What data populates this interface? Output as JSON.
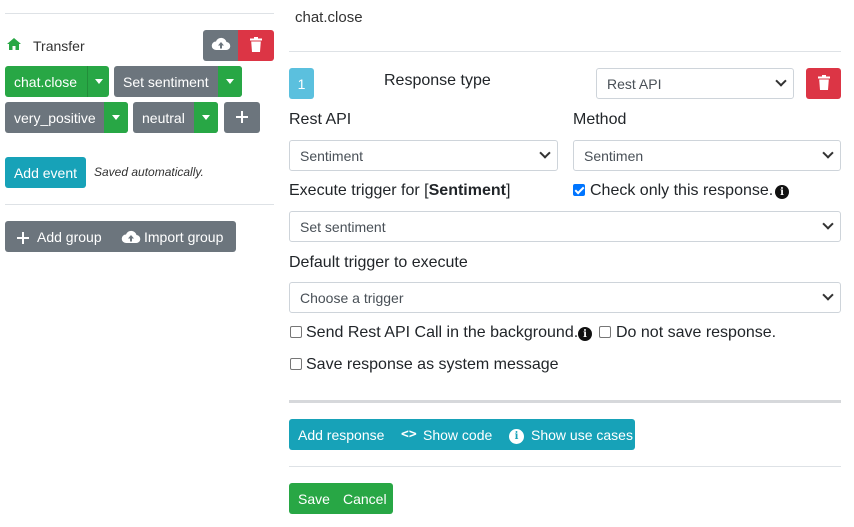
{
  "sidebar": {
    "home_label": "Transfer",
    "events": [
      {
        "label": "chat.close"
      },
      {
        "label": "Set sentiment"
      },
      {
        "label": "very_positive"
      },
      {
        "label": "neutral"
      }
    ],
    "add_event_label": "Add event",
    "saved_note": "Saved automatically.",
    "add_group_label": "Add group",
    "import_group_label": "Import group"
  },
  "main": {
    "title": "chat.close",
    "response_number": "1",
    "response_type_label": "Response type",
    "response_type_value": "Rest API",
    "rest_api_label": "Rest API",
    "rest_api_value": "Sentiment",
    "method_label": "Method",
    "method_value": "Sentimen",
    "execute_trigger_prefix": "Execute trigger for [",
    "execute_trigger_name": "Sentiment",
    "execute_trigger_suffix": "]",
    "check_only_label": "Check only this response.",
    "execute_trigger_value": "Set sentiment",
    "default_trigger_label": "Default trigger to execute",
    "default_trigger_placeholder": "Choose a trigger",
    "send_background_label": "Send Rest API Call in the background.",
    "do_not_save_label": "Do not save response.",
    "save_system_label": "Save response as system message",
    "add_response_label": "Add response",
    "show_code_label": "Show code",
    "show_use_cases_label": "Show use cases",
    "save_label": "Save",
    "cancel_label": "Cancel"
  },
  "colors": {
    "green": "#28a745",
    "gray": "#6c757d",
    "teal": "#17a2b8",
    "red": "#dc3545",
    "light_teal": "#5bc0de"
  }
}
